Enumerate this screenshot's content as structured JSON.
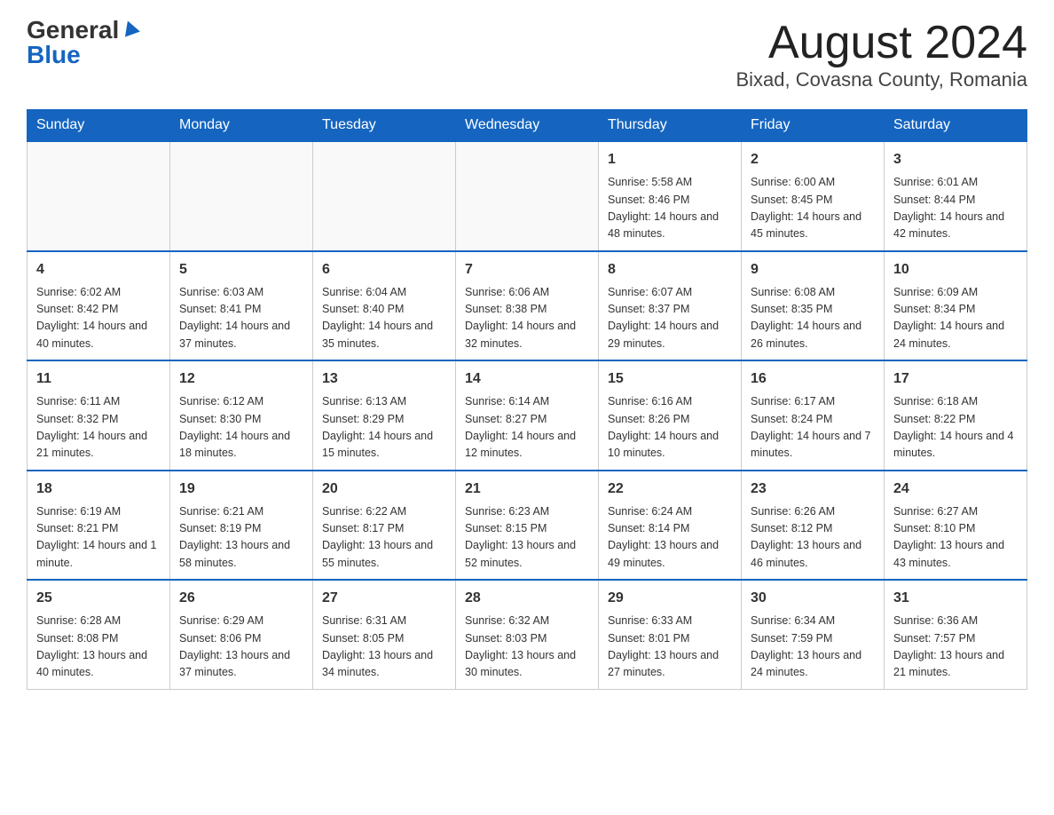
{
  "header": {
    "logo_general": "General",
    "logo_blue": "Blue",
    "month_title": "August 2024",
    "location": "Bixad, Covasna County, Romania"
  },
  "days_of_week": [
    "Sunday",
    "Monday",
    "Tuesday",
    "Wednesday",
    "Thursday",
    "Friday",
    "Saturday"
  ],
  "weeks": [
    [
      {
        "day": "",
        "info": ""
      },
      {
        "day": "",
        "info": ""
      },
      {
        "day": "",
        "info": ""
      },
      {
        "day": "",
        "info": ""
      },
      {
        "day": "1",
        "info": "Sunrise: 5:58 AM\nSunset: 8:46 PM\nDaylight: 14 hours and 48 minutes."
      },
      {
        "day": "2",
        "info": "Sunrise: 6:00 AM\nSunset: 8:45 PM\nDaylight: 14 hours and 45 minutes."
      },
      {
        "day": "3",
        "info": "Sunrise: 6:01 AM\nSunset: 8:44 PM\nDaylight: 14 hours and 42 minutes."
      }
    ],
    [
      {
        "day": "4",
        "info": "Sunrise: 6:02 AM\nSunset: 8:42 PM\nDaylight: 14 hours and 40 minutes."
      },
      {
        "day": "5",
        "info": "Sunrise: 6:03 AM\nSunset: 8:41 PM\nDaylight: 14 hours and 37 minutes."
      },
      {
        "day": "6",
        "info": "Sunrise: 6:04 AM\nSunset: 8:40 PM\nDaylight: 14 hours and 35 minutes."
      },
      {
        "day": "7",
        "info": "Sunrise: 6:06 AM\nSunset: 8:38 PM\nDaylight: 14 hours and 32 minutes."
      },
      {
        "day": "8",
        "info": "Sunrise: 6:07 AM\nSunset: 8:37 PM\nDaylight: 14 hours and 29 minutes."
      },
      {
        "day": "9",
        "info": "Sunrise: 6:08 AM\nSunset: 8:35 PM\nDaylight: 14 hours and 26 minutes."
      },
      {
        "day": "10",
        "info": "Sunrise: 6:09 AM\nSunset: 8:34 PM\nDaylight: 14 hours and 24 minutes."
      }
    ],
    [
      {
        "day": "11",
        "info": "Sunrise: 6:11 AM\nSunset: 8:32 PM\nDaylight: 14 hours and 21 minutes."
      },
      {
        "day": "12",
        "info": "Sunrise: 6:12 AM\nSunset: 8:30 PM\nDaylight: 14 hours and 18 minutes."
      },
      {
        "day": "13",
        "info": "Sunrise: 6:13 AM\nSunset: 8:29 PM\nDaylight: 14 hours and 15 minutes."
      },
      {
        "day": "14",
        "info": "Sunrise: 6:14 AM\nSunset: 8:27 PM\nDaylight: 14 hours and 12 minutes."
      },
      {
        "day": "15",
        "info": "Sunrise: 6:16 AM\nSunset: 8:26 PM\nDaylight: 14 hours and 10 minutes."
      },
      {
        "day": "16",
        "info": "Sunrise: 6:17 AM\nSunset: 8:24 PM\nDaylight: 14 hours and 7 minutes."
      },
      {
        "day": "17",
        "info": "Sunrise: 6:18 AM\nSunset: 8:22 PM\nDaylight: 14 hours and 4 minutes."
      }
    ],
    [
      {
        "day": "18",
        "info": "Sunrise: 6:19 AM\nSunset: 8:21 PM\nDaylight: 14 hours and 1 minute."
      },
      {
        "day": "19",
        "info": "Sunrise: 6:21 AM\nSunset: 8:19 PM\nDaylight: 13 hours and 58 minutes."
      },
      {
        "day": "20",
        "info": "Sunrise: 6:22 AM\nSunset: 8:17 PM\nDaylight: 13 hours and 55 minutes."
      },
      {
        "day": "21",
        "info": "Sunrise: 6:23 AM\nSunset: 8:15 PM\nDaylight: 13 hours and 52 minutes."
      },
      {
        "day": "22",
        "info": "Sunrise: 6:24 AM\nSunset: 8:14 PM\nDaylight: 13 hours and 49 minutes."
      },
      {
        "day": "23",
        "info": "Sunrise: 6:26 AM\nSunset: 8:12 PM\nDaylight: 13 hours and 46 minutes."
      },
      {
        "day": "24",
        "info": "Sunrise: 6:27 AM\nSunset: 8:10 PM\nDaylight: 13 hours and 43 minutes."
      }
    ],
    [
      {
        "day": "25",
        "info": "Sunrise: 6:28 AM\nSunset: 8:08 PM\nDaylight: 13 hours and 40 minutes."
      },
      {
        "day": "26",
        "info": "Sunrise: 6:29 AM\nSunset: 8:06 PM\nDaylight: 13 hours and 37 minutes."
      },
      {
        "day": "27",
        "info": "Sunrise: 6:31 AM\nSunset: 8:05 PM\nDaylight: 13 hours and 34 minutes."
      },
      {
        "day": "28",
        "info": "Sunrise: 6:32 AM\nSunset: 8:03 PM\nDaylight: 13 hours and 30 minutes."
      },
      {
        "day": "29",
        "info": "Sunrise: 6:33 AM\nSunset: 8:01 PM\nDaylight: 13 hours and 27 minutes."
      },
      {
        "day": "30",
        "info": "Sunrise: 6:34 AM\nSunset: 7:59 PM\nDaylight: 13 hours and 24 minutes."
      },
      {
        "day": "31",
        "info": "Sunrise: 6:36 AM\nSunset: 7:57 PM\nDaylight: 13 hours and 21 minutes."
      }
    ]
  ]
}
